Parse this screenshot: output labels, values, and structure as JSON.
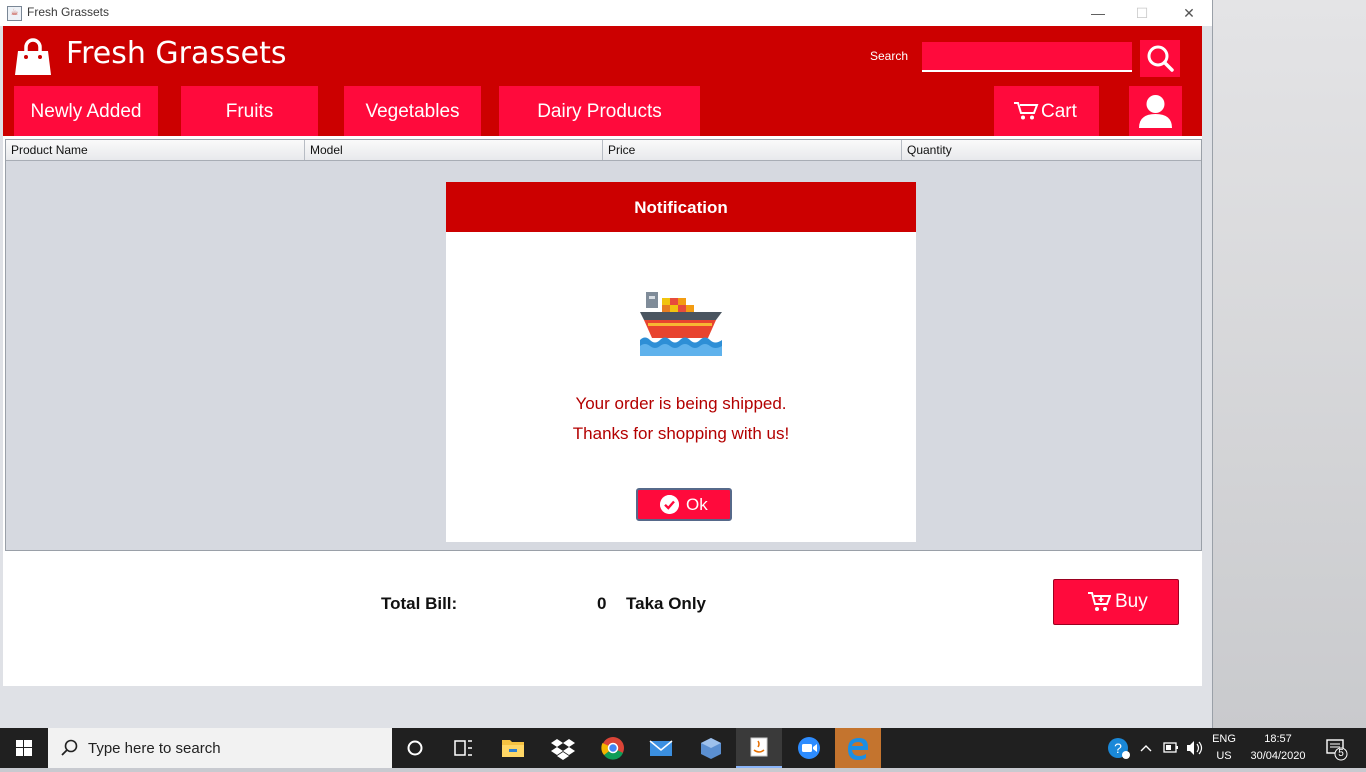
{
  "window": {
    "title": "Fresh Grassets",
    "controls": {
      "minimize": "—",
      "maximize": "☐",
      "close": "✕"
    }
  },
  "header": {
    "brand": "Fresh Grassets",
    "search_label": "Search",
    "search_value": "",
    "nav": [
      "Newly Added",
      "Fruits",
      "Vegetables",
      "Dairy Products"
    ],
    "cart_label": "Cart"
  },
  "table": {
    "columns": [
      "Product Name",
      "Model",
      "Price",
      "Quantity"
    ],
    "rows": []
  },
  "dialog": {
    "title": "Notification",
    "line1": "Your order is being shipped.",
    "line2": "Thanks for shopping with us!",
    "ok_label": "Ok"
  },
  "footer": {
    "total_label": "Total Bill:",
    "total_value": "0",
    "total_unit": "Taka Only",
    "buy_label": "Buy"
  },
  "taskbar": {
    "search_placeholder": "Type here to search",
    "lang_top": "ENG",
    "lang_bottom": "US",
    "time": "18:57",
    "date": "30/04/2020",
    "notification_count": "5"
  },
  "colors": {
    "header_red": "#cc0000",
    "accent_pink": "#ff0a3c",
    "message_red": "#b30000"
  }
}
